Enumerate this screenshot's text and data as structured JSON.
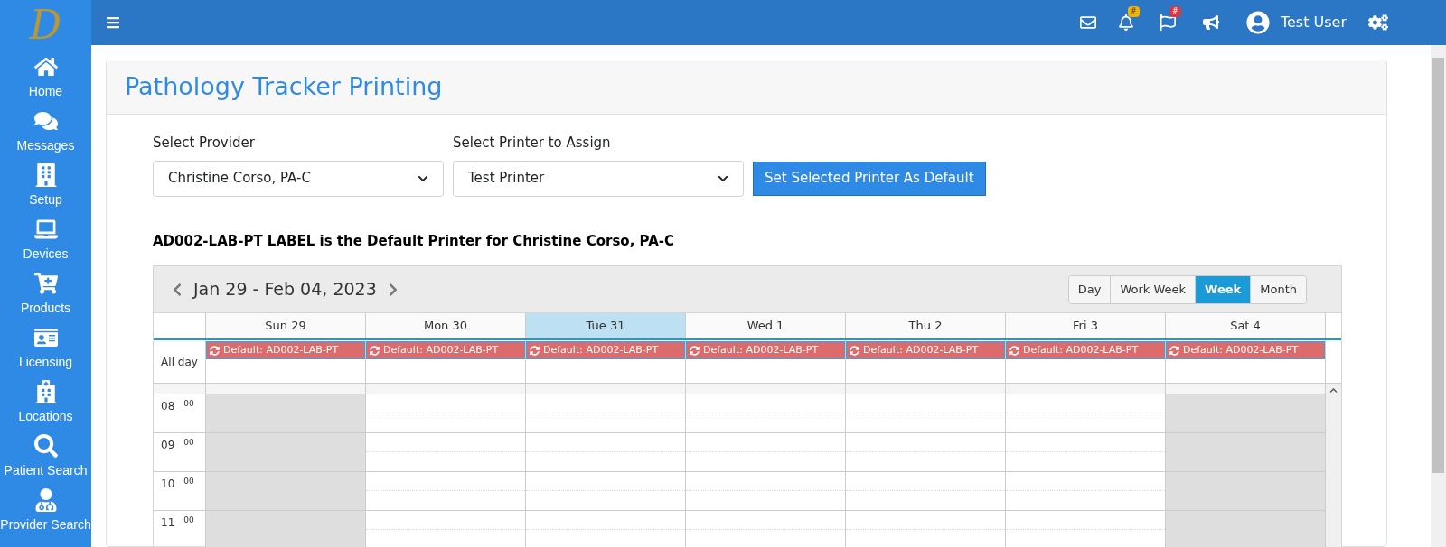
{
  "sidebar": {
    "logo": "D",
    "items": [
      {
        "kind": "home",
        "label": "Home"
      },
      {
        "kind": "messages",
        "label": "Messages"
      },
      {
        "kind": "setup",
        "label": "Setup"
      },
      {
        "kind": "devices",
        "label": "Devices"
      },
      {
        "kind": "products",
        "label": "Products"
      },
      {
        "kind": "licensing",
        "label": "Licensing"
      },
      {
        "kind": "locations",
        "label": "Locations"
      },
      {
        "kind": "search",
        "label": "Patient Search"
      },
      {
        "kind": "provider",
        "label": "Provider Search"
      }
    ]
  },
  "topbar": {
    "notifications_badge": "#",
    "flags_badge": "#",
    "user": "Test User"
  },
  "page": {
    "title": "Pathology Tracker Printing",
    "provider": {
      "label": "Select Provider",
      "value": "Christine Corso, PA-C"
    },
    "printer": {
      "label": "Select Printer to Assign",
      "value": "Test Printer"
    },
    "set_default_button": "Set Selected Printer As Default",
    "message": "AD002-LAB-PT LABEL is the Default Printer for Christine Corso, PA-C"
  },
  "calendar": {
    "range": "Jan 29 - Feb 04, 2023",
    "views": [
      {
        "label": "Day",
        "selected": false
      },
      {
        "label": "Work Week",
        "selected": false
      },
      {
        "label": "Week",
        "selected": true
      },
      {
        "label": "Month",
        "selected": false
      }
    ],
    "all_day_label": "All day",
    "days": [
      {
        "label": "Sun 29",
        "selected": false,
        "weekend": true,
        "event": "Default: AD002-LAB-PT"
      },
      {
        "label": "Mon 30",
        "selected": false,
        "weekend": false,
        "event": "Default: AD002-LAB-PT"
      },
      {
        "label": "Tue 31",
        "selected": true,
        "weekend": false,
        "event": "Default: AD002-LAB-PT"
      },
      {
        "label": "Wed 1",
        "selected": false,
        "weekend": false,
        "event": "Default: AD002-LAB-PT"
      },
      {
        "label": "Thu 2",
        "selected": false,
        "weekend": false,
        "event": "Default: AD002-LAB-PT"
      },
      {
        "label": "Fri 3",
        "selected": false,
        "weekend": false,
        "event": "Default: AD002-LAB-PT"
      },
      {
        "label": "Sat 4",
        "selected": false,
        "weekend": true,
        "event": "Default: AD002-LAB-PT"
      }
    ],
    "hours": [
      {
        "hour": "08",
        "minutes": "00"
      },
      {
        "hour": "09",
        "minutes": "00"
      },
      {
        "hour": "10",
        "minutes": "00"
      },
      {
        "hour": "11",
        "minutes": "00"
      }
    ]
  }
}
